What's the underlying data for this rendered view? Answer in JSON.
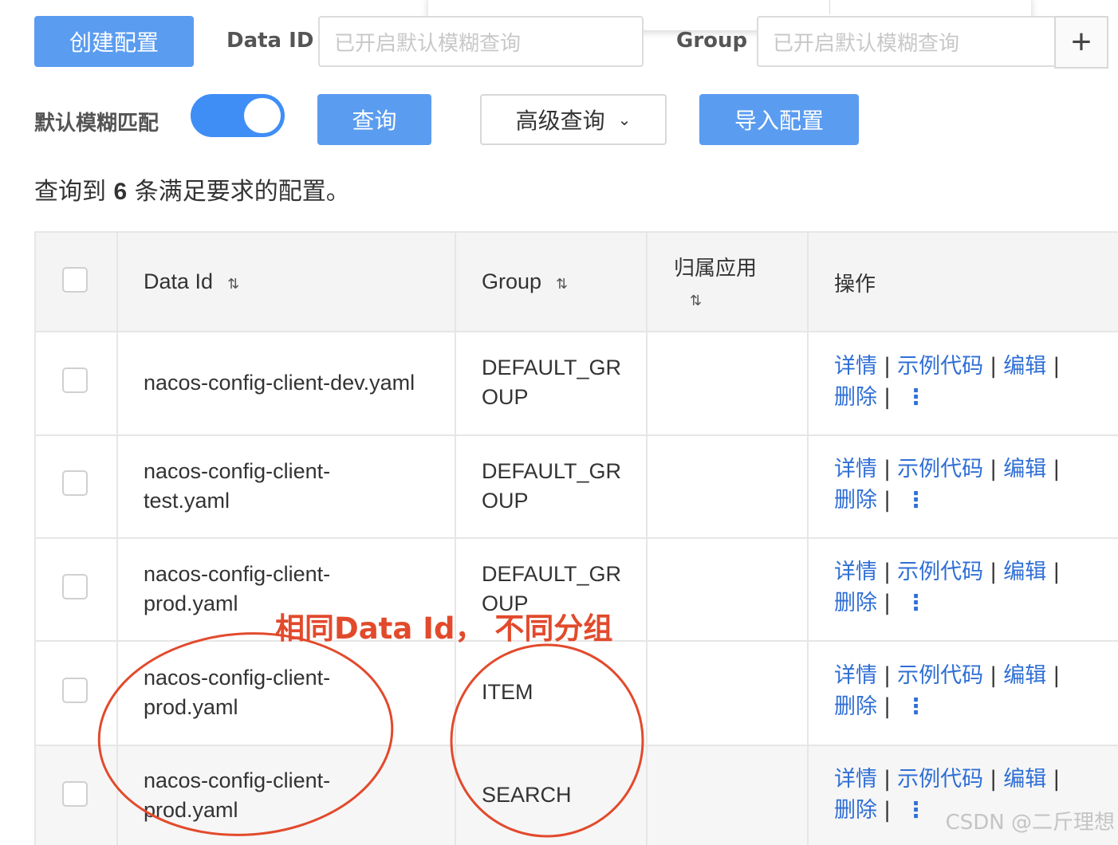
{
  "toolbar": {
    "create_label": "创建配置",
    "data_id_label": "Data ID",
    "data_id_placeholder": "已开启默认模糊查询",
    "group_label": "Group",
    "group_placeholder": "已开启默认模糊查询",
    "plus_glyph": "+",
    "fuzzy_label": "默认模糊匹配",
    "fuzzy_on": true,
    "query_label": "查询",
    "advanced_label": "高级查询",
    "advanced_caret": "⌄",
    "import_label": "导入配置"
  },
  "summary": {
    "prefix": "查询到 ",
    "count": "6",
    "suffix": " 条满足要求的配置。"
  },
  "table": {
    "headers": {
      "data_id": "Data Id",
      "group": "Group",
      "app": "归属应用",
      "ops": "操作",
      "sort_glyph": "⇅"
    },
    "rows": [
      {
        "data_id": [
          "nacos-config-client-dev.yaml"
        ],
        "group": [
          "DEFAULT_GR",
          "OUP"
        ]
      },
      {
        "data_id": [
          "nacos-config-client-",
          "test.yaml"
        ],
        "group": [
          "DEFAULT_GR",
          "OUP"
        ]
      },
      {
        "data_id": [
          "nacos-config-client-",
          "prod.yaml"
        ],
        "group": [
          "DEFAULT_GR",
          "OUP"
        ]
      },
      {
        "data_id": [
          "nacos-config-client-",
          "prod.yaml"
        ],
        "group": [
          "ITEM"
        ]
      },
      {
        "data_id": [
          "nacos-config-client-",
          "prod.yaml"
        ],
        "group": [
          "SEARCH"
        ]
      }
    ],
    "ops": {
      "detail": "详情",
      "sample": "示例代码",
      "edit": "编辑",
      "delete": "删除",
      "sep": "|",
      "more": "⋮"
    }
  },
  "annotation": {
    "text": "相同Data Id， 不同分组",
    "color": "#e24a2c"
  },
  "watermark": "CSDN @二斤理想",
  "colors": {
    "primary": "#5a9cf0",
    "toggle": "#3f8ef6",
    "link": "#2f6fd6"
  }
}
